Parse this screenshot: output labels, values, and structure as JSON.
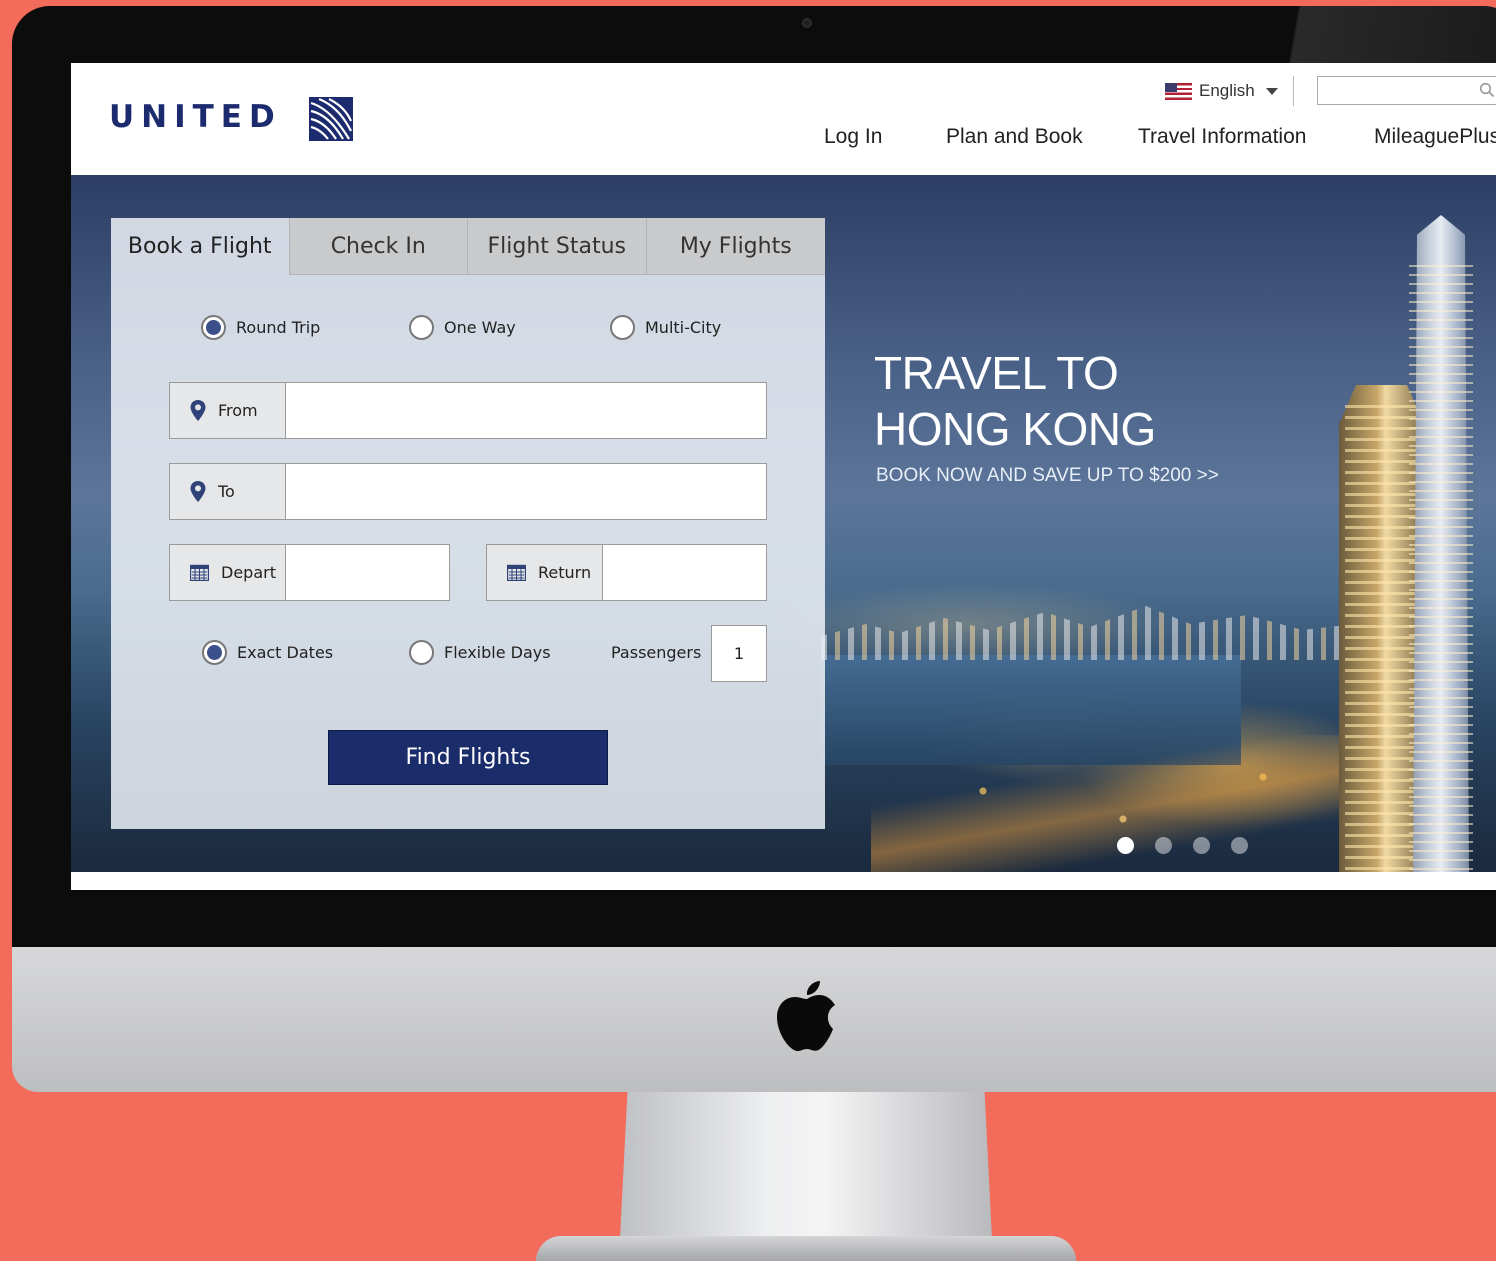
{
  "header": {
    "logo_text": "UNITED",
    "language": "English",
    "search": {
      "placeholder": "",
      "value": ""
    },
    "nav": [
      "Log In",
      "Plan and Book",
      "Travel Information",
      "MileaguePlus"
    ]
  },
  "booking": {
    "tabs": [
      "Book a Flight",
      "Check In",
      "Flight Status",
      "My Flights"
    ],
    "active_tab": "Book a Flight",
    "trip_types": [
      "Round Trip",
      "One Way",
      "Multi-City"
    ],
    "selected_trip_type": "Round Trip",
    "from_label": "From",
    "from_value": "",
    "to_label": "To",
    "to_value": "",
    "depart_label": "Depart",
    "depart_value": "",
    "return_label": "Return",
    "return_value": "",
    "date_options": [
      "Exact Dates",
      "Flexible Days"
    ],
    "selected_date_option": "Exact Dates",
    "passengers_label": "Passengers",
    "passengers_value": "1",
    "submit_label": "Find Flights"
  },
  "hero": {
    "title": "TRAVEL TO\nHONG KONG",
    "subtitle": "BOOK NOW AND SAVE UP TO $200 >>",
    "carousel_count": 4,
    "carousel_active_index": 0
  },
  "colors": {
    "background": "#f26b5b",
    "brand_navy": "#1b2c6b",
    "radio_selected": "#3b4f8a"
  }
}
